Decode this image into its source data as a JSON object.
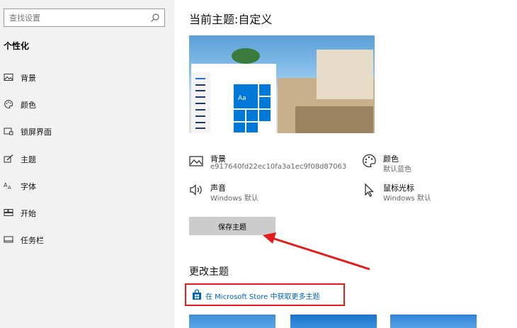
{
  "sidebar": {
    "search": {
      "placeholder": "查找设置"
    },
    "section_title": "个性化",
    "items": [
      {
        "label": "背景",
        "icon": "image-icon"
      },
      {
        "label": "颜色",
        "icon": "palette-icon"
      },
      {
        "label": "锁屏界面",
        "icon": "lock-screen-icon"
      },
      {
        "label": "主题",
        "icon": "theme-brush-icon"
      },
      {
        "label": "字体",
        "icon": "font-icon"
      },
      {
        "label": "开始",
        "icon": "start-icon"
      },
      {
        "label": "任务栏",
        "icon": "taskbar-icon"
      }
    ]
  },
  "main": {
    "title": "当前主题:自定义",
    "preview": {
      "tile_text": "Aa"
    },
    "properties": [
      {
        "name": "背景",
        "value": "e917640fd22ec10fa3a1ec9f08d87063",
        "icon": "image-icon"
      },
      {
        "name": "颜色",
        "value": "默认蓝色",
        "icon": "palette-icon"
      },
      {
        "name": "声音",
        "value": "Windows 默认",
        "icon": "speaker-icon"
      },
      {
        "name": "鼠标光标",
        "value": "Windows 默认",
        "icon": "cursor-icon"
      }
    ],
    "save_button": "保存主题",
    "change_title": "更改主题",
    "store_link": "在 Microsoft Store 中获取更多主题"
  },
  "colors": {
    "accent": "#0078d7",
    "link": "#0063b1",
    "highlight_red": "#e11c1c",
    "sidebar_bg": "#f2f2f2",
    "button_bg": "#cccccc"
  }
}
